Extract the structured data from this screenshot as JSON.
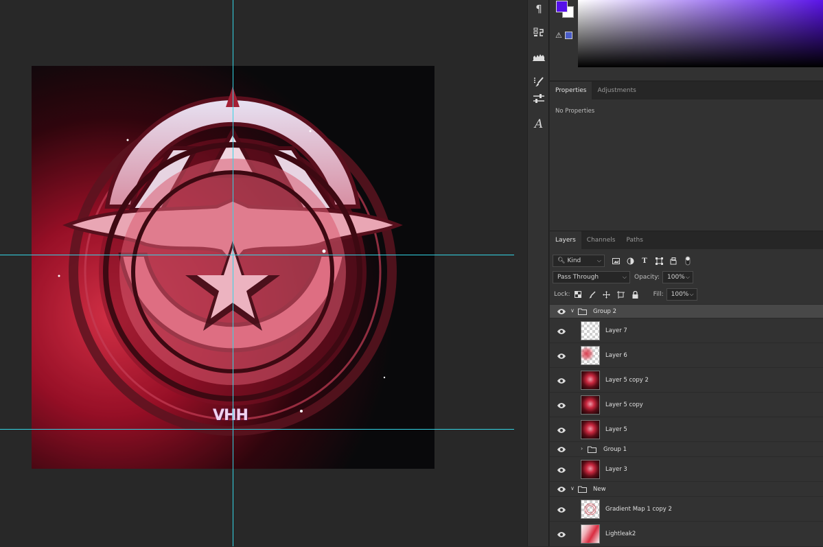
{
  "tools": [
    {
      "icon": "paragraph-icon",
      "glyph": "¶"
    },
    {
      "icon": "clone-source-icon"
    },
    {
      "icon": "histogram-icon"
    },
    {
      "icon": "brush-settings-icon"
    },
    {
      "icon": "adjust-sliders-icon"
    },
    {
      "icon": "glyphs-icon",
      "glyph": "A"
    }
  ],
  "color": {
    "foreground": "#5510ea",
    "background": "#ffffff",
    "gamut_warning": "⚠"
  },
  "properties_panel": {
    "tabs": [
      {
        "label": "Properties",
        "active": true
      },
      {
        "label": "Adjustments",
        "active": false
      }
    ],
    "message": "No Properties"
  },
  "layers_panel": {
    "tabs": [
      {
        "label": "Layers",
        "active": true
      },
      {
        "label": "Channels",
        "active": false
      },
      {
        "label": "Paths",
        "active": false
      }
    ],
    "filter_kind": "Kind",
    "blend_mode": "Pass Through",
    "opacity_label": "Opacity:",
    "opacity": "100%",
    "lock_label": "Lock:",
    "fill_label": "Fill:",
    "fill": "100%",
    "filter_icons": [
      "T"
    ],
    "layers": [
      {
        "name": "Group 2",
        "type": "group",
        "expanded": true,
        "selected": true
      },
      {
        "name": "Layer 7",
        "type": "layer",
        "thumb": "empty"
      },
      {
        "name": "Layer 6",
        "type": "layer",
        "thumb": "art6"
      },
      {
        "name": "Layer 5 copy 2",
        "type": "layer",
        "thumb": "art"
      },
      {
        "name": "Layer 5 copy",
        "type": "layer",
        "thumb": "art"
      },
      {
        "name": "Layer 5",
        "type": "layer",
        "thumb": "art"
      },
      {
        "name": "Group 1",
        "type": "group",
        "expanded": false
      },
      {
        "name": "Layer 3",
        "type": "layer",
        "thumb": "art"
      },
      {
        "name": "New",
        "type": "group",
        "expanded": true
      },
      {
        "name": "Gradient Map 1 copy 2",
        "type": "layer",
        "thumb": "gm"
      },
      {
        "name": "Lightleak2",
        "type": "layer",
        "thumb": "leak"
      }
    ]
  },
  "artwork": {
    "signature": "VHH"
  }
}
